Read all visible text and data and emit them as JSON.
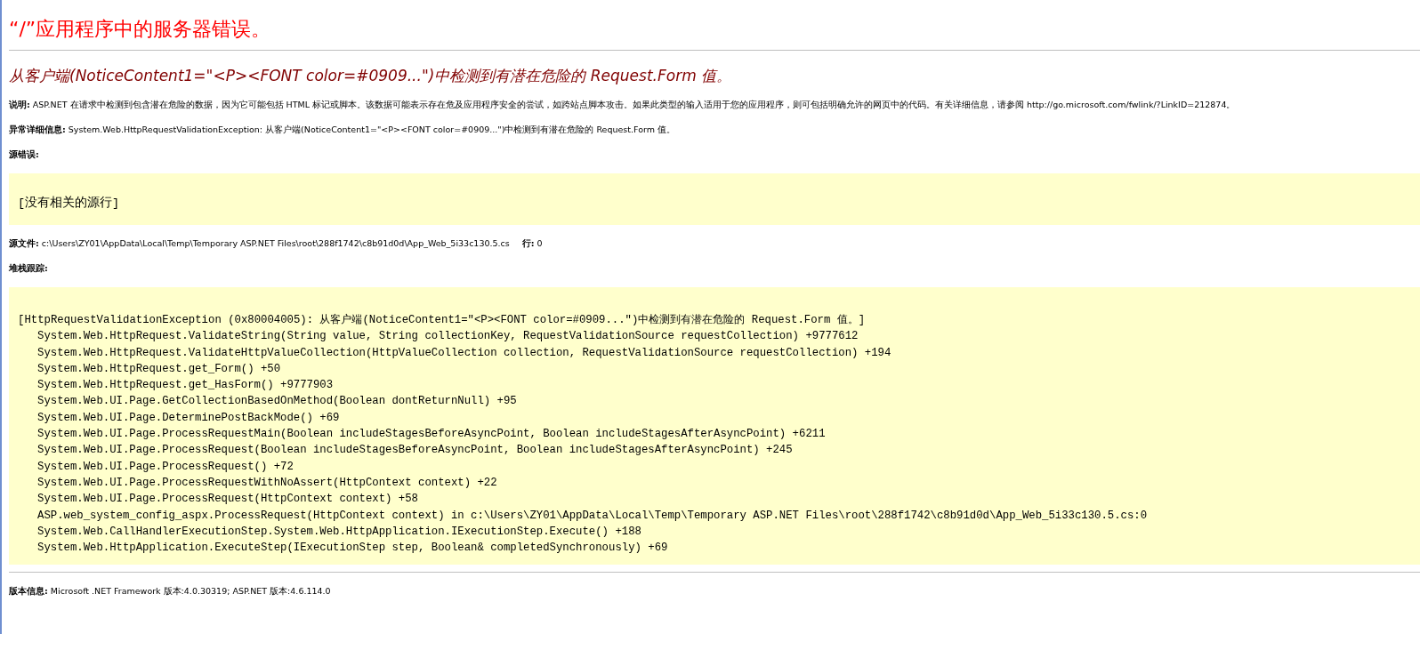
{
  "error_title": "“/”应用程序中的服务器错误。",
  "error_message": "从客户端(NoticeContent1=\"<P><FONT color=#0909...\")中检测到有潜在危险的 Request.Form 值。",
  "description": {
    "label": "说明:",
    "text": "ASP.NET 在请求中检测到包含潜在危险的数据，因为它可能包括 HTML 标记或脚本。该数据可能表示存在危及应用程序安全的尝试，如跨站点脚本攻击。如果此类型的输入适用于您的应用程序，则可包括明确允许的网页中的代码。有关详细信息，请参阅 http://go.microsoft.com/fwlink/?LinkID=212874。"
  },
  "exception_details": {
    "label": "异常详细信息:",
    "text": "System.Web.HttpRequestValidationException: 从客户端(NoticeContent1=\"<P><FONT color=#0909...\")中检测到有潜在危险的 Request.Form 值。"
  },
  "source_error": {
    "label": "源错误:",
    "code": "[没有相关的源行]"
  },
  "source_file": {
    "label": "源文件:",
    "path": "c:\\Users\\ZY01\\AppData\\Local\\Temp\\Temporary ASP.NET Files\\root\\288f1742\\c8b91d0d\\App_Web_5i33c130.5.cs",
    "line_label": "行:",
    "line": "0"
  },
  "stack_trace": {
    "label": "堆栈跟踪:",
    "header": "[HttpRequestValidationException (0x80004005): 从客户端(NoticeContent1=\"<P><FONT color=#0909...\")中检测到有潜在危险的 Request.Form 值。]",
    "frames": [
      "System.Web.HttpRequest.ValidateString(String value, String collectionKey, RequestValidationSource requestCollection) +9777612",
      "System.Web.HttpRequest.ValidateHttpValueCollection(HttpValueCollection collection, RequestValidationSource requestCollection) +194",
      "System.Web.HttpRequest.get_Form() +50",
      "System.Web.HttpRequest.get_HasForm() +9777903",
      "System.Web.UI.Page.GetCollectionBasedOnMethod(Boolean dontReturnNull) +95",
      "System.Web.UI.Page.DeterminePostBackMode() +69",
      "System.Web.UI.Page.ProcessRequestMain(Boolean includeStagesBeforeAsyncPoint, Boolean includeStagesAfterAsyncPoint) +6211",
      "System.Web.UI.Page.ProcessRequest(Boolean includeStagesBeforeAsyncPoint, Boolean includeStagesAfterAsyncPoint) +245",
      "System.Web.UI.Page.ProcessRequest() +72",
      "System.Web.UI.Page.ProcessRequestWithNoAssert(HttpContext context) +22",
      "System.Web.UI.Page.ProcessRequest(HttpContext context) +58",
      "ASP.web_system_config_aspx.ProcessRequest(HttpContext context) in c:\\Users\\ZY01\\AppData\\Local\\Temp\\Temporary ASP.NET Files\\root\\288f1742\\c8b91d0d\\App_Web_5i33c130.5.cs:0",
      "System.Web.CallHandlerExecutionStep.System.Web.HttpApplication.IExecutionStep.Execute() +188",
      "System.Web.HttpApplication.ExecuteStep(IExecutionStep step, Boolean& completedSynchronously) +69"
    ]
  },
  "version_info": {
    "label": "版本信息:",
    "text": "Microsoft .NET Framework 版本:4.0.30319; ASP.NET 版本:4.6.114.0"
  }
}
